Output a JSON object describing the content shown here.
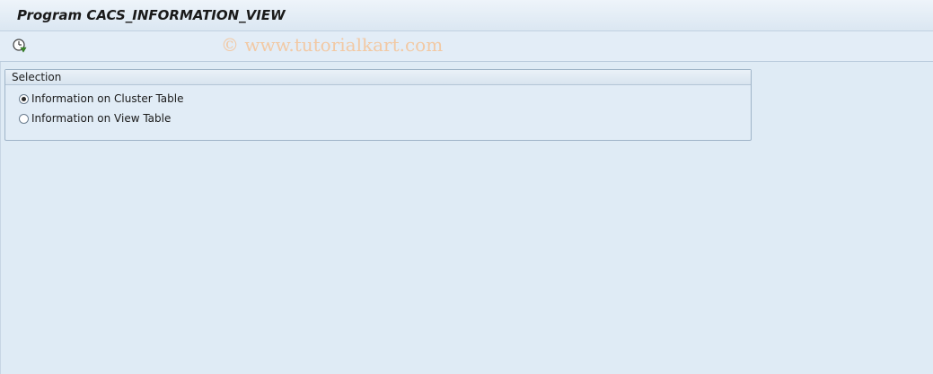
{
  "window": {
    "title": "Program CACS_INFORMATION_VIEW"
  },
  "toolbar": {
    "execute_icon": "execute-clock-icon",
    "watermark": "© www.tutorialkart.com"
  },
  "selection": {
    "title": "Selection",
    "options": [
      {
        "label": "Information on Cluster Table",
        "checked": true
      },
      {
        "label": "Information on View Table",
        "checked": false
      }
    ]
  },
  "colors": {
    "background": "#dfebf5",
    "watermark": "#f2c9a4",
    "execute_icon_green": "#3a8a2a"
  }
}
